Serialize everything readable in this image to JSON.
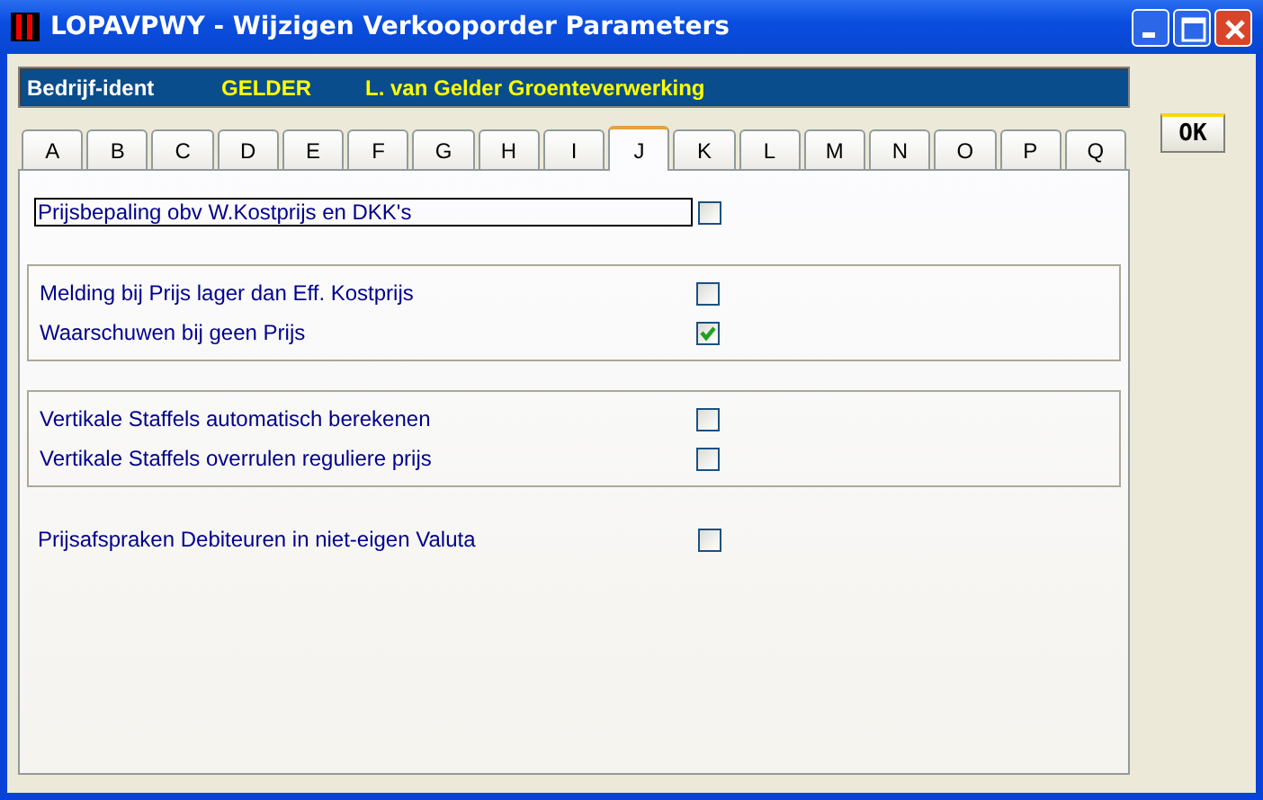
{
  "window": {
    "title": "LOPAVPWY - Wijzigen Verkooporder Parameters"
  },
  "company": {
    "label": "Bedrijf-ident",
    "code": "GELDER",
    "name": "L. van Gelder Groenteverwerking"
  },
  "tabs": [
    {
      "label": "A",
      "selected": false
    },
    {
      "label": "B",
      "selected": false
    },
    {
      "label": "C",
      "selected": false
    },
    {
      "label": "D",
      "selected": false
    },
    {
      "label": "E",
      "selected": false
    },
    {
      "label": "F",
      "selected": false
    },
    {
      "label": "G",
      "selected": false
    },
    {
      "label": "H",
      "selected": false
    },
    {
      "label": "I",
      "selected": false
    },
    {
      "label": "J",
      "selected": true
    },
    {
      "label": "K",
      "selected": false
    },
    {
      "label": "L",
      "selected": false
    },
    {
      "label": "M",
      "selected": false
    },
    {
      "label": "N",
      "selected": false
    },
    {
      "label": "O",
      "selected": false
    },
    {
      "label": "P",
      "selected": false
    },
    {
      "label": "Q",
      "selected": false
    }
  ],
  "groups": [
    {
      "framed": false,
      "items": [
        {
          "label": "Prijsbepaling obv W.Kostprijs en DKK's",
          "checked": false,
          "focused": true
        }
      ]
    },
    {
      "framed": true,
      "items": [
        {
          "label": "Melding bij Prijs lager dan Eff. Kostprijs",
          "checked": false,
          "focused": false
        },
        {
          "label": "Waarschuwen bij geen Prijs",
          "checked": true,
          "focused": false
        }
      ]
    },
    {
      "framed": true,
      "items": [
        {
          "label": "Vertikale Staffels automatisch berekenen",
          "checked": false,
          "focused": false
        },
        {
          "label": "Vertikale Staffels overrulen reguliere prijs",
          "checked": false,
          "focused": false
        }
      ]
    },
    {
      "framed": false,
      "items": [
        {
          "label": "Prijsafspraken Debiteuren in niet-eigen Valuta",
          "checked": false,
          "focused": false
        }
      ]
    }
  ],
  "buttons": [
    {
      "label": "OK"
    }
  ]
}
